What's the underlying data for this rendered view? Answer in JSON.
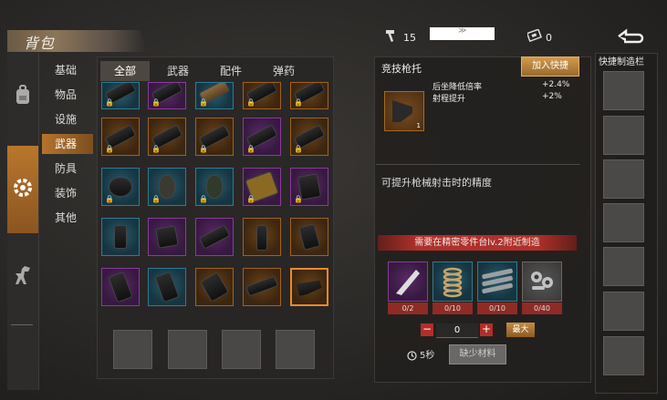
{
  "header": {
    "title": "背包",
    "hammer_count": "15",
    "dropdown_glyph": "≫",
    "ticket_count": "0"
  },
  "categories": [
    {
      "label": "基础",
      "active": false
    },
    {
      "label": "物品",
      "active": false
    },
    {
      "label": "设施",
      "active": false
    },
    {
      "label": "武器",
      "active": true
    },
    {
      "label": "防具",
      "active": false
    },
    {
      "label": "装饰",
      "active": false
    },
    {
      "label": "其他",
      "active": false
    }
  ],
  "tabs": [
    {
      "label": "全部",
      "active": true
    },
    {
      "label": "武器",
      "active": false
    },
    {
      "label": "配件",
      "active": false
    },
    {
      "label": "弹药",
      "active": false
    }
  ],
  "detail": {
    "name": "竞技枪托",
    "add_quick": "加入快捷",
    "item_count": "1",
    "stats": [
      {
        "label": "后坐降低倍率",
        "value": "+2.4%"
      },
      {
        "label": "射程提升",
        "value": "+2%"
      }
    ],
    "description": "可提升枪械射击时的精度",
    "requirement": "需要在精密零件台lv.2附近制造",
    "materials": [
      {
        "name": "plate",
        "count": "0/2",
        "rarity": "purple"
      },
      {
        "name": "spring",
        "count": "0/10",
        "rarity": "blue"
      },
      {
        "name": "pipe",
        "count": "0/10",
        "rarity": "blue"
      },
      {
        "name": "bolts",
        "count": "0/40",
        "rarity": "gray"
      }
    ],
    "quantity": "0",
    "max_label": "最大",
    "time": "5秒",
    "craft_label": "缺少材料"
  },
  "quick_craft": {
    "title": "快捷制造栏"
  },
  "icons": {
    "hammer": "hammer-icon",
    "ticket": "ticket-icon",
    "back": "back-arrow-icon",
    "backpack": "backpack-icon",
    "gear": "gear-icon",
    "dino": "dinosaur-icon",
    "clock": "clock-icon",
    "lock": "lock-icon"
  }
}
